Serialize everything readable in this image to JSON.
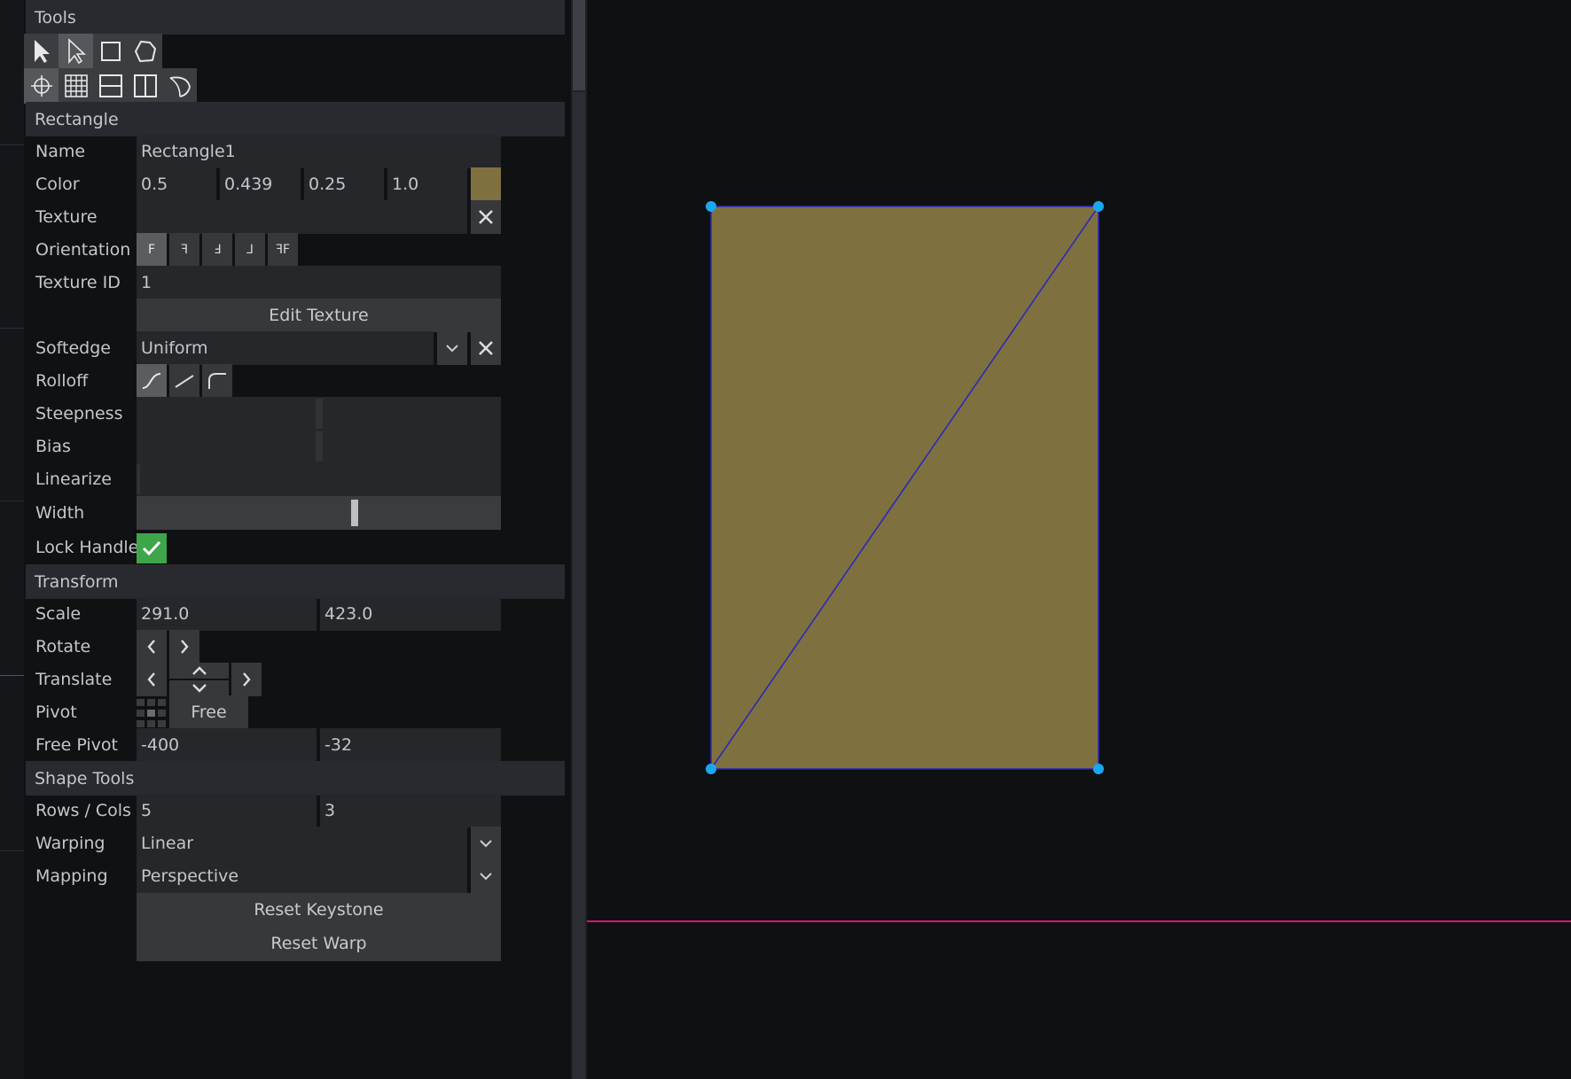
{
  "panel": {
    "tools_header": "Tools",
    "tools_row1": [
      {
        "icon": "select-arrow-icon",
        "active": false
      },
      {
        "icon": "direct-select-arrow-icon",
        "active": true
      },
      {
        "icon": "rectangle-shape-icon",
        "active": false
      },
      {
        "icon": "freeform-shape-icon",
        "active": false
      }
    ],
    "tools_row2": [
      {
        "icon": "crosshair-icon",
        "active": true
      },
      {
        "icon": "grid-icon",
        "active": false
      },
      {
        "icon": "horizontal-split-icon",
        "active": false
      },
      {
        "icon": "vertical-split-icon",
        "active": false
      },
      {
        "icon": "circle-segment-icon",
        "active": false
      }
    ],
    "rectangle_header": "Rectangle",
    "name": {
      "label": "Name",
      "value": "Rectangle1"
    },
    "color": {
      "label": "Color",
      "r": "0.5",
      "g": "0.439",
      "b": "0.25",
      "a": "1.0",
      "swatch": "#7f7040"
    },
    "texture": {
      "label": "Texture",
      "value": "",
      "clear_icon": "close-icon"
    },
    "orientation": {
      "label": "Orientation",
      "options": [
        "F",
        "ꟻ",
        "Ⅎ",
        "⅃",
        "ꟻF"
      ],
      "selected": 0
    },
    "texture_id": {
      "label": "Texture ID",
      "value": "1"
    },
    "edit_texture_label": "Edit Texture",
    "softedge": {
      "label": "Softedge",
      "value": "Uniform"
    },
    "rolloff": {
      "label": "Rolloff",
      "options": [
        "s-curve-icon",
        "linear-ramp-icon",
        "ease-out-curve-icon"
      ],
      "selected": 0
    },
    "steepness": {
      "label": "Steepness",
      "level": 0.5
    },
    "bias": {
      "label": "Bias",
      "level": 0.5
    },
    "linearize": {
      "label": "Linearize",
      "level": 0.0
    },
    "width": {
      "label": "Width",
      "level": 0.6
    },
    "lock_handle": {
      "label": "Lock Handle",
      "checked": true
    },
    "transform_header": "Transform",
    "scale": {
      "label": "Scale",
      "x": "291.0",
      "y": "423.0"
    },
    "rotate": {
      "label": "Rotate"
    },
    "translate": {
      "label": "Translate"
    },
    "pivot": {
      "label": "Pivot",
      "value": "Free"
    },
    "free_pivot": {
      "label": "Free Pivot",
      "x": "-400",
      "y": "-32"
    },
    "shape_tools_header": "Shape Tools",
    "rows_cols": {
      "label": "Rows / Cols",
      "rows": "5",
      "cols": "3"
    },
    "warping": {
      "label": "Warping",
      "value": "Linear"
    },
    "mapping": {
      "label": "Mapping",
      "value": "Perspective"
    },
    "reset_keystone_label": "Reset Keystone",
    "reset_warp_label": "Reset Warp"
  },
  "canvas": {
    "fill_color": "#7f7040",
    "outline_color": "#2a2ab8",
    "handle_color": "#19a8f0",
    "guide_color": "#e0107a",
    "background": "#0f1012"
  }
}
